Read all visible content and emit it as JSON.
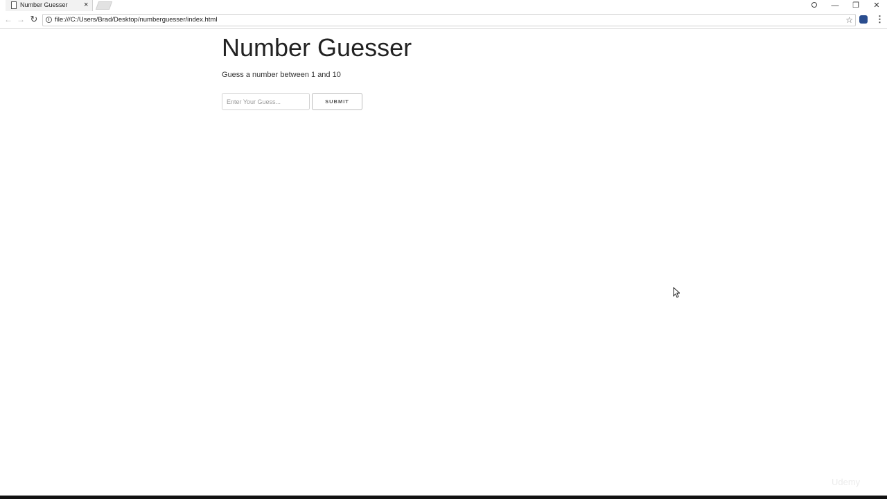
{
  "browser": {
    "tab_title": "Number Guesser",
    "tab_close": "×",
    "url": "file:///C:/Users/Brad/Desktop/numberguesser/index.html",
    "window_controls": {
      "minimize": "—",
      "restore": "❐",
      "close": "✕"
    },
    "nav": {
      "back": "←",
      "forward": "→",
      "reload": "↻"
    },
    "star": "☆",
    "menu": "⋮"
  },
  "page": {
    "title": "Number Guesser",
    "instructions": "Guess a number between 1 and 10",
    "guess_input": {
      "value": "",
      "placeholder": "Enter Your Guess..."
    },
    "submit_label": "SUBMIT"
  },
  "watermark": "Udemy",
  "colors": {
    "accent_extension": "#2a4d8f",
    "text": "#222222",
    "background": "#ffffff"
  }
}
